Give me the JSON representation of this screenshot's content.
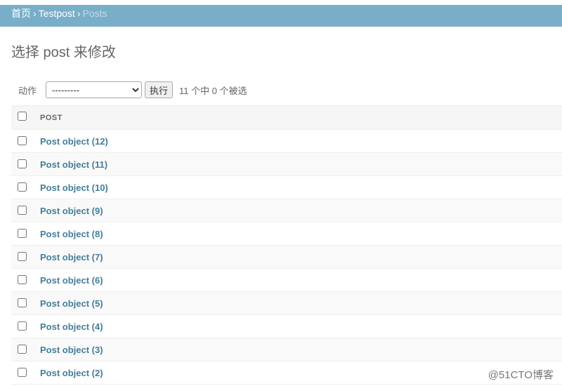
{
  "breadcrumbs": {
    "home": "首页",
    "separator": "›",
    "app": "Testpost",
    "current": "Posts"
  },
  "page_title": "选择 post 来修改",
  "actions": {
    "label": "动作",
    "selected_option": "---------",
    "go_button": "执行",
    "counter": "11 个中 0 个被选"
  },
  "table": {
    "column_header": "POST",
    "rows": [
      "Post object (12)",
      "Post object (11)",
      "Post object (10)",
      "Post object (9)",
      "Post object (8)",
      "Post object (7)",
      "Post object (6)",
      "Post object (5)",
      "Post object (4)",
      "Post object (3)",
      "Post object (2)"
    ]
  },
  "watermark": "@51CTO博客",
  "colors": {
    "header_bar": "#79aec8",
    "link": "#447e9b"
  }
}
